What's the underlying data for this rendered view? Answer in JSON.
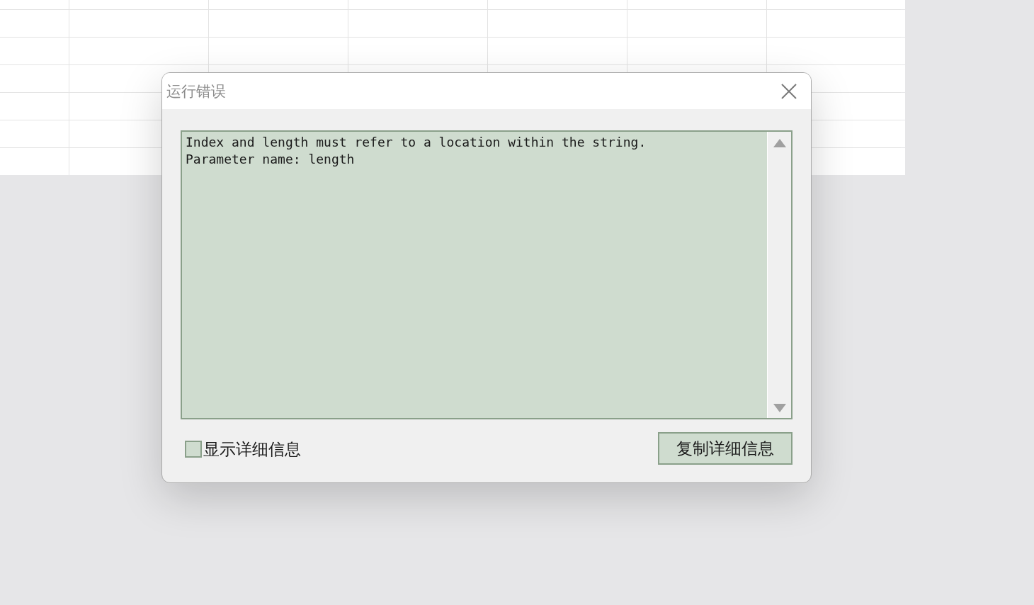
{
  "dialog": {
    "title": "运行错误",
    "message_lines": [
      "Index and length must refer to a location within the string.",
      "Parameter name: length"
    ],
    "checkbox": {
      "label": "显示详细信息",
      "checked": false
    },
    "button": "复制详细信息"
  }
}
